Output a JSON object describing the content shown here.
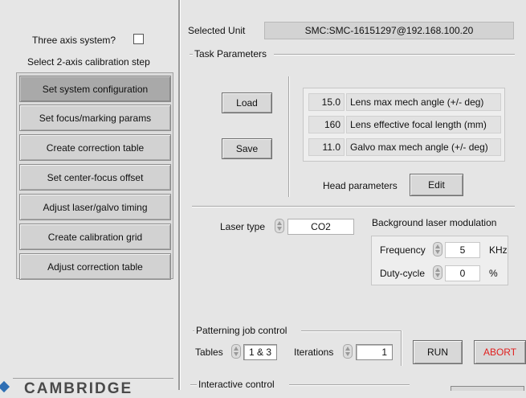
{
  "left": {
    "three_axis_label": "Three axis system?",
    "three_axis_checked": false,
    "steps_heading": "Select 2-axis calibration step",
    "steps": [
      {
        "label": "Set system configuration",
        "active": true
      },
      {
        "label": "Set focus/marking params",
        "active": false
      },
      {
        "label": "Create correction table",
        "active": false
      },
      {
        "label": "Set center-focus offset",
        "active": false
      },
      {
        "label": "Adjust laser/galvo timing",
        "active": false
      },
      {
        "label": "Create calibration grid",
        "active": false
      },
      {
        "label": "Adjust correction table",
        "active": false
      }
    ],
    "logo_text": "CAMBRIDGE"
  },
  "header": {
    "selected_unit_label": "Selected Unit",
    "selected_unit_value": "SMC:SMC-16151297@192.168.100.20"
  },
  "task": {
    "group_label": "Task Parameters",
    "load_label": "Load",
    "save_label": "Save",
    "lens_params": [
      {
        "value": "15.0",
        "label": "Lens max mech angle (+/- deg)"
      },
      {
        "value": "160",
        "label": "Lens effective focal length (mm)"
      },
      {
        "value": "11.0",
        "label": "Galvo max mech angle (+/- deg)"
      }
    ],
    "head_params_label": "Head parameters",
    "edit_label": "Edit"
  },
  "laser": {
    "type_label": "Laser type",
    "type_value": "CO2",
    "bg_mod_label": "Background laser modulation",
    "frequency_label": "Frequency",
    "frequency_value": "5",
    "frequency_unit": "KHz",
    "duty_label": "Duty-cycle",
    "duty_value": "0",
    "duty_unit": "%"
  },
  "patterning": {
    "group_label": "Patterning job control",
    "tables_label": "Tables",
    "tables_value": "1 & 3",
    "iterations_label": "Iterations",
    "iterations_value": "1",
    "run_label": "RUN",
    "abort_label": "ABORT",
    "abort_color": "#e0201f"
  },
  "interactive": {
    "group_label": "Interactive control"
  }
}
